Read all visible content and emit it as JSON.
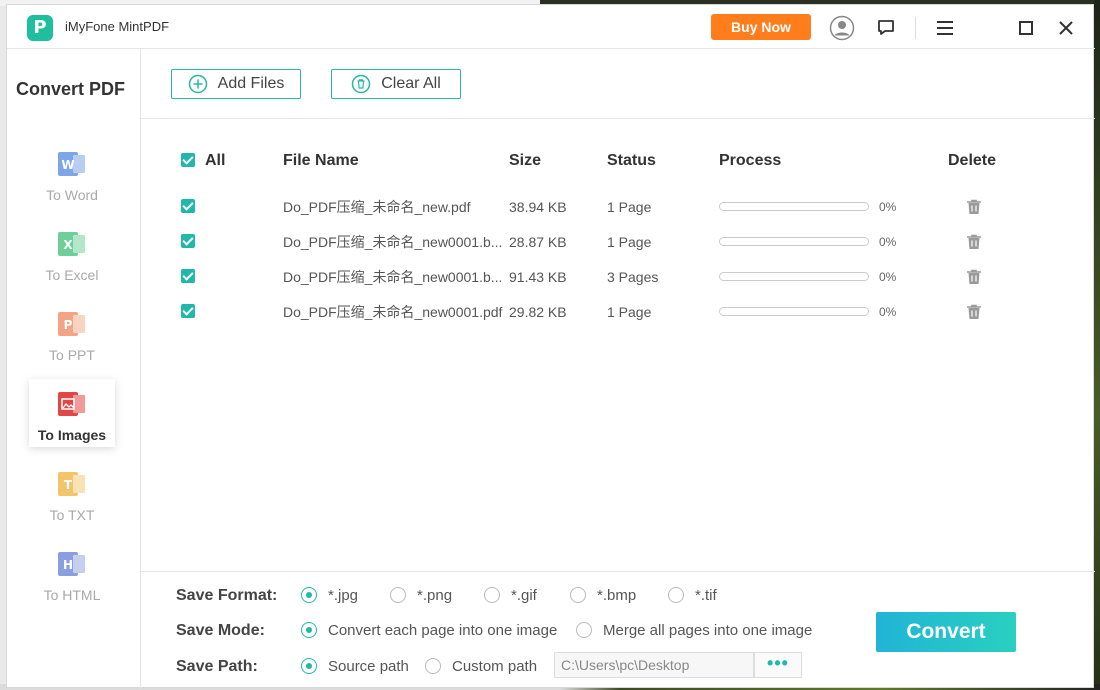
{
  "app": {
    "logo_letter": "P",
    "title": "iMyFone MintPDF",
    "buy_now": "Buy Now"
  },
  "titlebar_icons": [
    "user-icon",
    "feedback-icon",
    "menu-icon",
    "maximize-icon",
    "close-icon"
  ],
  "sidebar": {
    "title": "Convert PDF",
    "items": [
      {
        "label": "To Word",
        "letter": "W",
        "color": "#7ea5e8",
        "active": false
      },
      {
        "label": "To Excel",
        "letter": "X",
        "color": "#6fcf9a",
        "active": false
      },
      {
        "label": "To PPT",
        "letter": "P",
        "color": "#f3a487",
        "active": false
      },
      {
        "label": "To Images",
        "letter": "",
        "color": "#e04747",
        "active": true
      },
      {
        "label": "To TXT",
        "letter": "T",
        "color": "#f3c46b",
        "active": false
      },
      {
        "label": "To HTML",
        "letter": "H",
        "color": "#8a9ee0",
        "active": false
      }
    ]
  },
  "toolbar": {
    "add_files": "Add Files",
    "clear_all": "Clear All"
  },
  "table": {
    "headers": {
      "all": "All",
      "file_name": "File Name",
      "size": "Size",
      "status": "Status",
      "process": "Process",
      "delete": "Delete"
    },
    "rows": [
      {
        "checked": true,
        "file_name": "Do_PDF压缩_未命名_new.pdf",
        "size": "38.94 KB",
        "status": "1 Page",
        "progress": 0,
        "progress_label": "0%"
      },
      {
        "checked": true,
        "file_name": "Do_PDF压缩_未命名_new0001.b...",
        "size": "28.87 KB",
        "status": "1 Page",
        "progress": 0,
        "progress_label": "0%"
      },
      {
        "checked": true,
        "file_name": "Do_PDF压缩_未命名_new0001.b...",
        "size": "91.43 KB",
        "status": "3 Pages",
        "progress": 0,
        "progress_label": "0%"
      },
      {
        "checked": true,
        "file_name": "Do_PDF压缩_未命名_new0001.pdf",
        "size": "29.82 KB",
        "status": "1 Page",
        "progress": 0,
        "progress_label": "0%"
      }
    ]
  },
  "bottom": {
    "save_format_label": "Save Format:",
    "formats": [
      {
        "label": "*.jpg",
        "selected": true
      },
      {
        "label": "*.png",
        "selected": false
      },
      {
        "label": "*.gif",
        "selected": false
      },
      {
        "label": "*.bmp",
        "selected": false
      },
      {
        "label": "*.tif",
        "selected": false
      }
    ],
    "save_mode_label": "Save Mode:",
    "modes": [
      {
        "label": "Convert each page into one image",
        "selected": true
      },
      {
        "label": "Merge all pages into one image",
        "selected": false
      }
    ],
    "save_path_label": "Save Path:",
    "paths": [
      {
        "label": "Source path",
        "selected": true
      },
      {
        "label": "Custom path",
        "selected": false
      }
    ],
    "path_value": "C:\\Users\\pc\\Desktop",
    "browse_label": "•••",
    "convert_label": "Convert"
  },
  "colors": {
    "accent": "#1fb8aa",
    "buy": "#ff7e1b",
    "logo": "#1fbf9e"
  }
}
